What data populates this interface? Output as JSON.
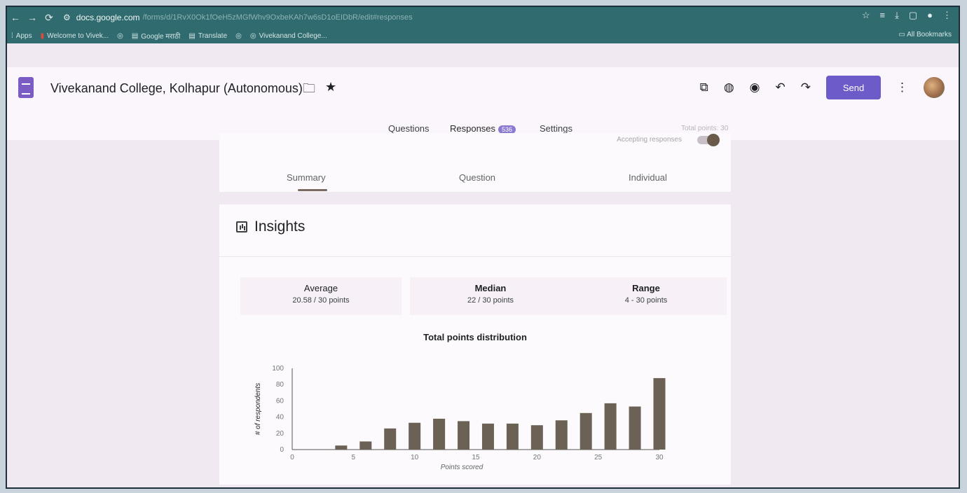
{
  "browser": {
    "host": "docs.google.com",
    "path": "/forms/d/1RvX0Ok1fOeH5zMGfWhv9OxbeKAh7w6sD1oEIDbR/edit#responses",
    "bookmarks": [
      "Apps",
      "Welcome to Vivek...",
      "Google मराठी",
      "Translate",
      "Vivekanand College..."
    ],
    "all_bookmarks": "All Bookmarks"
  },
  "form": {
    "title": "Vivekanand College, Kolhapur (Autonomous)",
    "send_label": "Send",
    "tabs": [
      {
        "label": "Questions"
      },
      {
        "label": "Responses",
        "badge": "536"
      },
      {
        "label": "Settings"
      }
    ],
    "total_points": "Total points: 30"
  },
  "responses": {
    "accepting_label": "Accepting responses",
    "subtabs": [
      "Summary",
      "Question",
      "Individual"
    ]
  },
  "insights": {
    "title": "Insights",
    "stats": [
      {
        "label": "Average",
        "value": "20.58 / 30 points"
      },
      {
        "label": "Median",
        "value": "22 / 30 points"
      },
      {
        "label": "Range",
        "value": "4 - 30 points"
      }
    ]
  },
  "chart_data": {
    "type": "bar",
    "title": "Total points distribution",
    "xlabel": "Points scored",
    "ylabel": "# of respondents",
    "x": [
      4,
      6,
      8,
      10,
      12,
      14,
      16,
      18,
      20,
      22,
      24,
      26,
      28,
      30
    ],
    "values": [
      5,
      10,
      26,
      33,
      38,
      35,
      32,
      32,
      30,
      36,
      45,
      57,
      53,
      88
    ],
    "xticks": [
      0,
      5,
      10,
      15,
      20,
      25,
      30
    ],
    "yticks": [
      0,
      20,
      40,
      60,
      80,
      100
    ],
    "xlim": [
      0,
      30
    ],
    "ylim": [
      0,
      100
    ],
    "color": "#6b6155"
  }
}
